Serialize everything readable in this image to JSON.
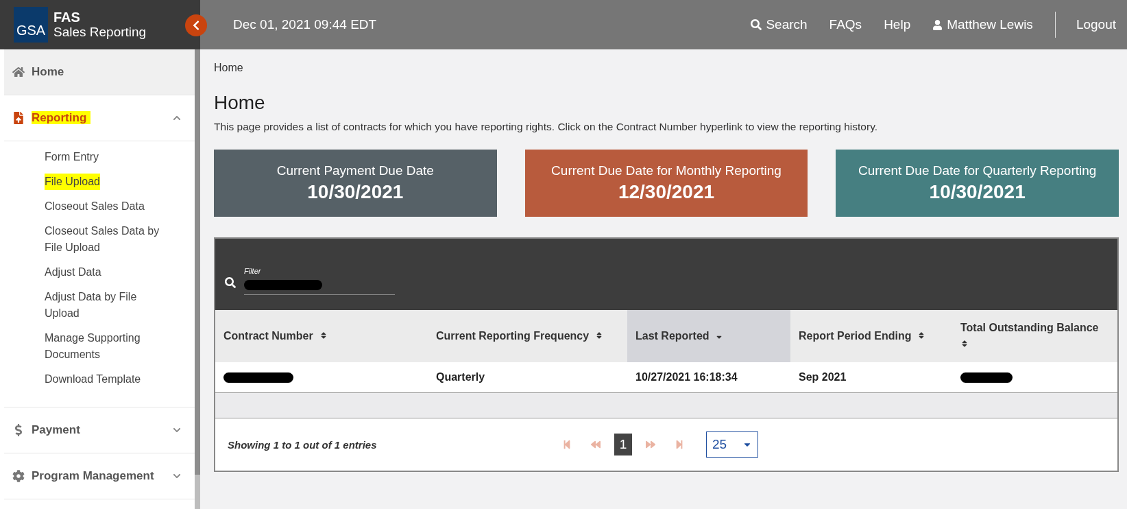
{
  "header": {
    "logo": "GSA",
    "app_title": "FAS",
    "app_subtitle": "Sales Reporting",
    "datetime": "Dec 01, 2021 09:44 EDT",
    "nav": [
      {
        "label": "Search"
      },
      {
        "label": "FAQs"
      },
      {
        "label": "Help"
      },
      {
        "label": "Matthew Lewis"
      },
      {
        "label": "Logout"
      }
    ]
  },
  "sidebar": {
    "items": [
      {
        "label": "Home",
        "selected": false,
        "hovered": true,
        "highlighted": false
      },
      {
        "label": "Reporting",
        "selected": true,
        "hovered": false,
        "highlighted": true,
        "expanded": true,
        "children": [
          {
            "label": "Form Entry",
            "highlighted": false
          },
          {
            "label": "File Upload",
            "highlighted": true
          },
          {
            "label": "Closeout Sales Data",
            "highlighted": false
          },
          {
            "label": "Closeout Sales Data by File Upload",
            "highlighted": false
          },
          {
            "label": "Adjust Data",
            "highlighted": false
          },
          {
            "label": "Adjust Data by File Upload",
            "highlighted": false
          },
          {
            "label": "Manage Supporting Documents",
            "highlighted": false
          },
          {
            "label": "Download Template",
            "highlighted": false
          }
        ]
      },
      {
        "label": "Payment",
        "selected": false,
        "hovered": false,
        "highlighted": false,
        "expanded": false
      },
      {
        "label": "Program Management",
        "selected": false,
        "hovered": false,
        "highlighted": false,
        "expanded": false
      }
    ]
  },
  "breadcrumb": "Home",
  "title": "Home",
  "description": "This page provides a list of contracts for which you have reporting rights. Click on the Contract Number hyperlink to view the reporting history.",
  "cards": [
    {
      "title": "Current Payment Due Date",
      "date": "10/30/2021",
      "color": "#566167"
    },
    {
      "title": "Current Due Date for Monthly Reporting",
      "date": "12/30/2021",
      "color": "#b85b3d"
    },
    {
      "title": "Current Due Date for Quarterly Reporting",
      "date": "10/30/2021",
      "color": "#467f81"
    }
  ],
  "table": {
    "filter": {
      "label": "Filter",
      "redacted": true
    },
    "columns": [
      {
        "label": "Contract Number",
        "selected": false
      },
      {
        "label": "Current Reporting Frequency",
        "selected": false
      },
      {
        "label": "Last Reported",
        "selected": true
      },
      {
        "label": "Report Period Ending",
        "selected": false
      },
      {
        "label": "Total Outstanding Balance",
        "selected": false
      }
    ],
    "rows": [
      [
        {
          "kind": "redacted"
        },
        {
          "kind": "text",
          "text": "Quarterly"
        },
        {
          "kind": "text",
          "text": "10/27/2021  16:18:34"
        },
        {
          "kind": "text",
          "text": "Sep 2021"
        },
        {
          "kind": "redacted"
        }
      ]
    ],
    "summary": "Showing 1 to 1 out of 1 entries",
    "pager": [
      {
        "kind": "first",
        "disabled": true
      },
      {
        "kind": "prev",
        "disabled": true
      },
      {
        "kind": "page",
        "label": "1",
        "selected": true
      },
      {
        "kind": "next",
        "disabled": true
      },
      {
        "kind": "last",
        "disabled": true
      }
    ],
    "page_size": "25"
  }
}
